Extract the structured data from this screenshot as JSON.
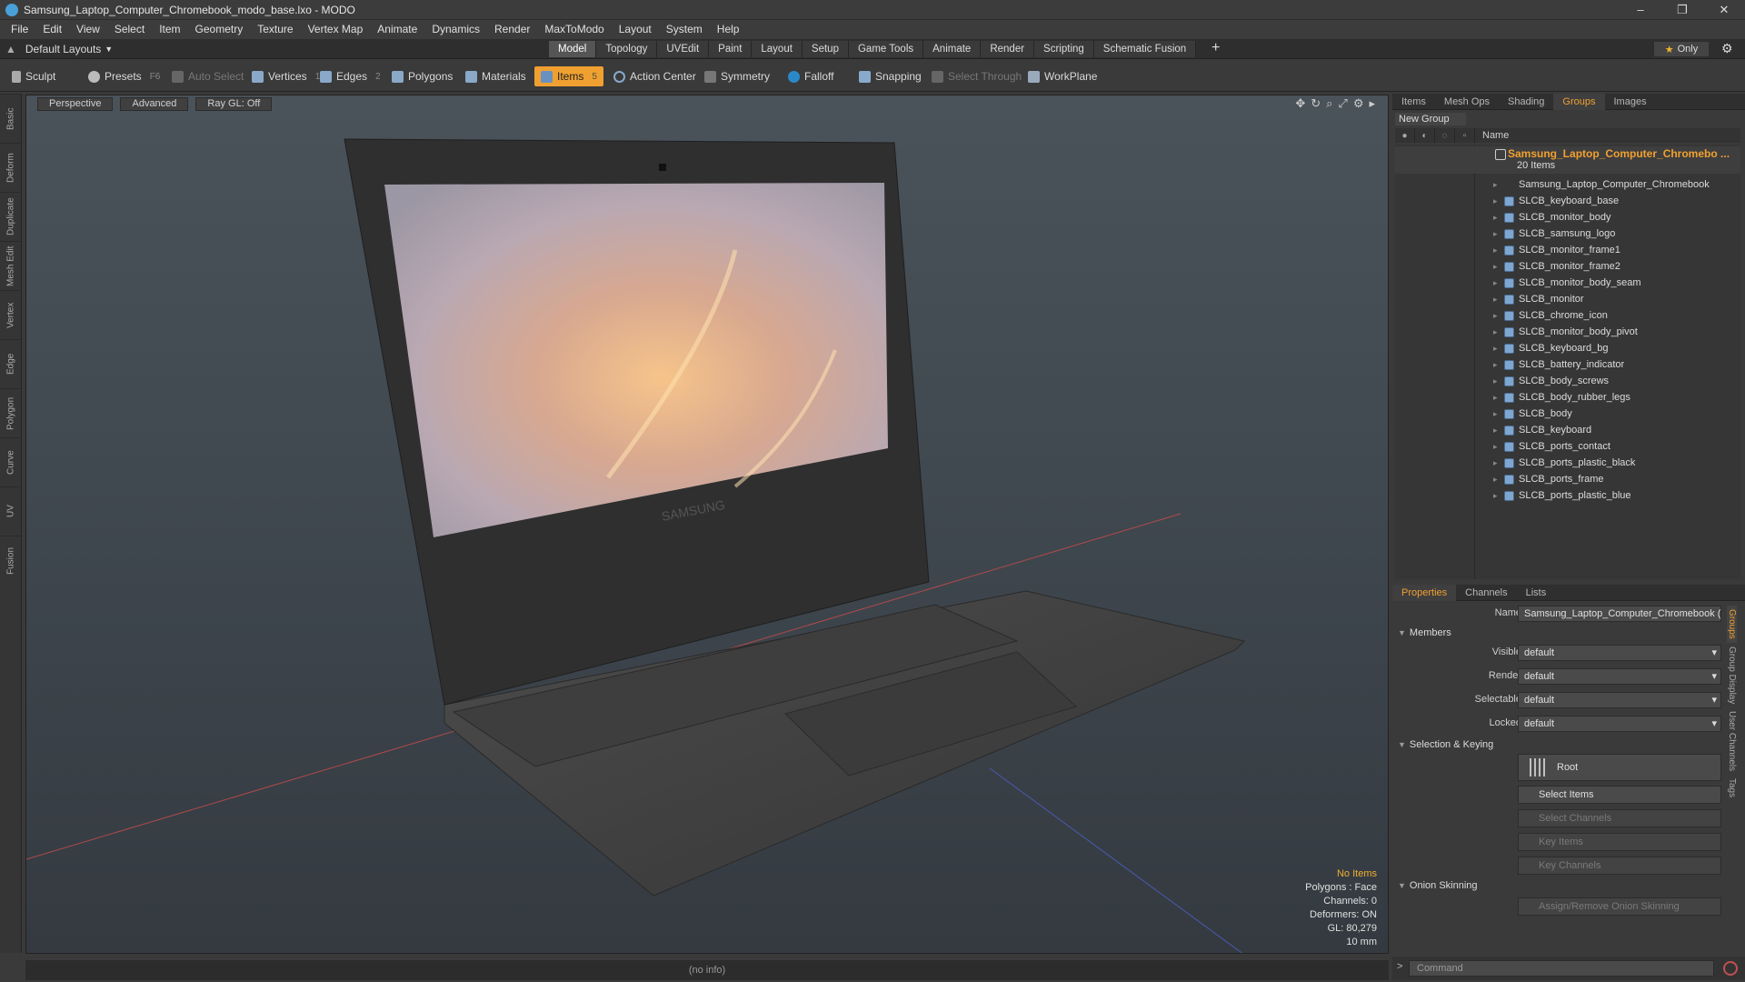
{
  "window": {
    "title": "Samsung_Laptop_Computer_Chromebook_modo_base.lxo - MODO",
    "controls": [
      "–",
      "❐",
      "✕"
    ]
  },
  "menu": [
    "File",
    "Edit",
    "View",
    "Select",
    "Item",
    "Geometry",
    "Texture",
    "Vertex Map",
    "Animate",
    "Dynamics",
    "Render",
    "MaxToModo",
    "Layout",
    "System",
    "Help"
  ],
  "layoutbar": {
    "layout_selector": "Default Layouts",
    "tabs": [
      "Model",
      "Topology",
      "UVEdit",
      "Paint",
      "Layout",
      "Setup",
      "Game Tools",
      "Animate",
      "Render",
      "Scripting",
      "Schematic Fusion"
    ],
    "active_tab": "Model",
    "only_label": "Only"
  },
  "toolbar": {
    "sculpt": "Sculpt",
    "presets": "Presets",
    "presets_key": "F6",
    "auto_select": "Auto Select",
    "vertices": "Vertices",
    "vertices_key": "1",
    "edges": "Edges",
    "edges_key": "2",
    "polygons": "Polygons",
    "materials": "Materials",
    "items": "Items",
    "items_key": "5",
    "action_center": "Action Center",
    "symmetry": "Symmetry",
    "falloff": "Falloff",
    "snapping": "Snapping",
    "select_through": "Select Through",
    "workplane": "WorkPlane"
  },
  "left_tabs": [
    "Basic",
    "Deform",
    "Duplicate",
    "Mesh Edit",
    "Vertex",
    "Edge",
    "Polygon",
    "Curve",
    "UV",
    "Fusion"
  ],
  "viewport": {
    "view_mode": "Perspective",
    "shading": "Advanced",
    "raygl": "Ray GL: Off",
    "screen_brand": "SAMSUNG",
    "hud": {
      "no_items": "No Items",
      "polygons": "Polygons : Face",
      "channels": "Channels: 0",
      "deformers": "Deformers: ON",
      "gl": "GL: 80,279",
      "scale": "10 mm"
    }
  },
  "status": "(no info)",
  "right_panel": {
    "tabs": [
      "Items",
      "Mesh Ops",
      "Shading",
      "Groups",
      "Images"
    ],
    "active_tab": "Groups",
    "new_group": "New Group",
    "name_col": "Name",
    "group": {
      "name": "Samsung_Laptop_Computer_Chromebo ...",
      "count": "20 Items"
    },
    "items": [
      "Samsung_Laptop_Computer_Chromebook",
      "SLCB_keyboard_base",
      "SLCB_monitor_body",
      "SLCB_samsung_logo",
      "SLCB_monitor_frame1",
      "SLCB_monitor_frame2",
      "SLCB_monitor_body_seam",
      "SLCB_monitor",
      "SLCB_chrome_icon",
      "SLCB_monitor_body_pivot",
      "SLCB_keyboard_bg",
      "SLCB_battery_indicator",
      "SLCB_body_screws",
      "SLCB_body_rubber_legs",
      "SLCB_body",
      "SLCB_keyboard",
      "SLCB_ports_contact",
      "SLCB_ports_plastic_black",
      "SLCB_ports_frame",
      "SLCB_ports_plastic_blue"
    ]
  },
  "properties": {
    "tabs": [
      "Properties",
      "Channels",
      "Lists"
    ],
    "active_tab": "Properties",
    "name_label": "Name",
    "name_value": "Samsung_Laptop_Computer_Chromebook (:",
    "members_section": "Members",
    "visible_label": "Visible",
    "visible_value": "default",
    "render_label": "Render",
    "render_value": "default",
    "selectable_label": "Selectable",
    "selectable_value": "default",
    "locked_label": "Locked",
    "locked_value": "default",
    "selection_section": "Selection & Keying",
    "root_btn": "Root",
    "select_items": "Select Items",
    "select_channels": "Select Channels",
    "key_items": "Key Items",
    "key_channels": "Key Channels",
    "onion_section": "Onion Skinning",
    "onion_btn": "Assign/Remove Onion Skinning",
    "side_tabs": [
      "Groups",
      "Group Display",
      "User Channels",
      "Tags"
    ]
  },
  "command": {
    "placeholder": "Command"
  },
  "colors": {
    "accent": "#f0a030",
    "panel": "#3a3a3a",
    "item_icon": "#7fa6cf"
  }
}
